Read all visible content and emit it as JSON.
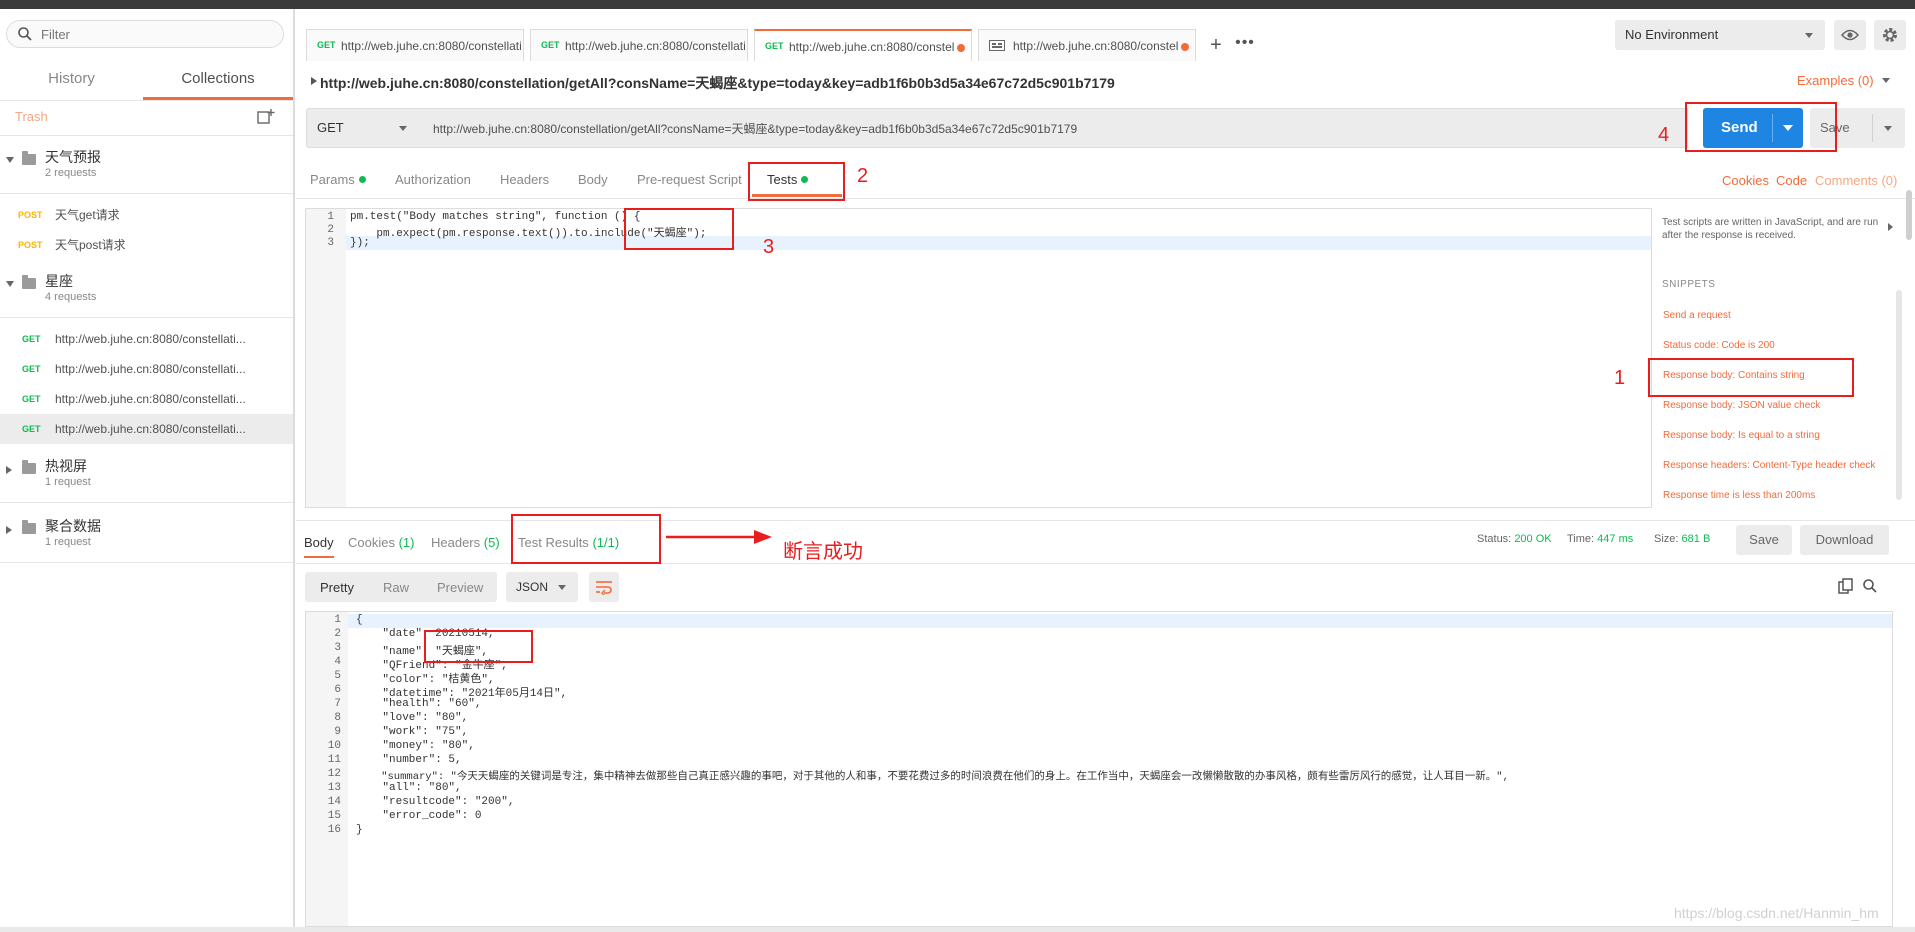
{
  "sidebar": {
    "filter_placeholder": "Filter",
    "tabs": [
      {
        "label": "History"
      },
      {
        "label": "Collections"
      }
    ],
    "trash_label": "Trash",
    "collections": [
      {
        "name": "天气预报",
        "count": "2 requests",
        "expanded": true,
        "requests": [
          {
            "method": "POST",
            "name": "天气get请求"
          },
          {
            "method": "POST",
            "name": "天气post请求"
          }
        ]
      },
      {
        "name": "星座",
        "count": "4 requests",
        "expanded": true,
        "requests": [
          {
            "method": "GET",
            "name": "http://web.juhe.cn:8080/constellati..."
          },
          {
            "method": "GET",
            "name": "http://web.juhe.cn:8080/constellati..."
          },
          {
            "method": "GET",
            "name": "http://web.juhe.cn:8080/constellati..."
          },
          {
            "method": "GET",
            "name": "http://web.juhe.cn:8080/constellati..."
          }
        ]
      },
      {
        "name": "热视屏",
        "count": "1 request",
        "expanded": false
      },
      {
        "name": "聚合数据",
        "count": "1 request",
        "expanded": false
      }
    ]
  },
  "tabs": [
    {
      "method": "GET",
      "url": "http://web.juhe.cn:8080/constellatio"
    },
    {
      "method": "GET",
      "url": "http://web.juhe.cn:8080/constellatio"
    },
    {
      "method": "GET",
      "url": "http://web.juhe.cn:8080/constell"
    },
    {
      "method": "",
      "url": "http://web.juhe.cn:8080/constell"
    }
  ],
  "environment": "No Environment",
  "request": {
    "title": "http://web.juhe.cn:8080/constellation/getAll?consName=天蝎座&type=today&key=adb1f6b0b3d5a34e67c72d5c901b7179",
    "examples_label": "Examples (0)",
    "method": "GET",
    "url": "http://web.juhe.cn:8080/constellation/getAll?consName=天蝎座&type=today&key=adb1f6b0b3d5a34e67c72d5c901b7179",
    "send_label": "Send",
    "save_label": "Save"
  },
  "request_tabs": [
    "Params",
    "Authorization",
    "Headers",
    "Body",
    "Pre-request Script",
    "Tests"
  ],
  "request_links": [
    "Cookies",
    "Code",
    "Comments (0)"
  ],
  "test_code": {
    "line_numbers": [
      "1",
      "2",
      "3"
    ],
    "lines": [
      "pm.test(\"Body matches string\", function () {",
      "    pm.expect(pm.response.text()).to.include(\"天蝎座\");",
      "});"
    ]
  },
  "snippets": {
    "description": "Test scripts are written in JavaScript, and are run after the response is received.",
    "title": "SNIPPETS",
    "items": [
      "Send a request",
      "Status code: Code is 200",
      "Response body: Contains string",
      "Response body: JSON value check",
      "Response body: Is equal to a string",
      "Response headers: Content-Type header check",
      "Response time is less than 200ms"
    ]
  },
  "response": {
    "tabs": {
      "body": "Body",
      "cookies": "Cookies",
      "cookies_count": "(1)",
      "headers": "Headers",
      "headers_count": "(5)",
      "tests": "Test Results",
      "tests_count": "(1/1)"
    },
    "status_label": "Status:",
    "status": "200 OK",
    "time_label": "Time:",
    "time": "447 ms",
    "size_label": "Size:",
    "size": "681 B",
    "save_label": "Save",
    "download_label": "Download",
    "views": [
      "Pretty",
      "Raw",
      "Preview"
    ],
    "format": "JSON",
    "line_numbers": [
      "1",
      "2",
      "3",
      "4",
      "5",
      "6",
      "7",
      "8",
      "9",
      "10",
      "11",
      "12",
      "13",
      "14",
      "15",
      "16"
    ],
    "lines": [
      "{",
      "    \"date\": 20210514,",
      "    \"name\": \"天蝎座\",",
      "    \"QFriend\": \"金牛座\",",
      "    \"color\": \"桔黄色\",",
      "    \"datetime\": \"2021年05月14日\",",
      "    \"health\": \"60\",",
      "    \"love\": \"80\",",
      "    \"work\": \"75\",",
      "    \"money\": \"80\",",
      "    \"number\": 5,",
      "    \"summary\": \"今天天蝎座的关键词是专注，集中精神去做那些自己真正感兴趣的事吧，对于其他的人和事，不要花费过多的时间浪费在他们的身上。在工作当中，天蝎座会一改懒懒散散的办事风格，颇有些雷厉风行的感觉，让人耳目一新。\",",
      "    \"all\": \"80\",",
      "    \"resultcode\": \"200\",",
      "    \"error_code\": 0",
      "}"
    ]
  },
  "annotations": {
    "n1": "1",
    "n2": "2",
    "n3": "3",
    "n4": "4",
    "success_text": "断言成功"
  },
  "watermark": "https://blog.csdn.net/Hanmin_hm",
  "colors": {
    "accent": "#f26b3a",
    "send_blue": "#1f85e3",
    "get_green": "#0cbb52",
    "post_yellow": "#ffb400",
    "annotation_red": "#e81e1e"
  }
}
